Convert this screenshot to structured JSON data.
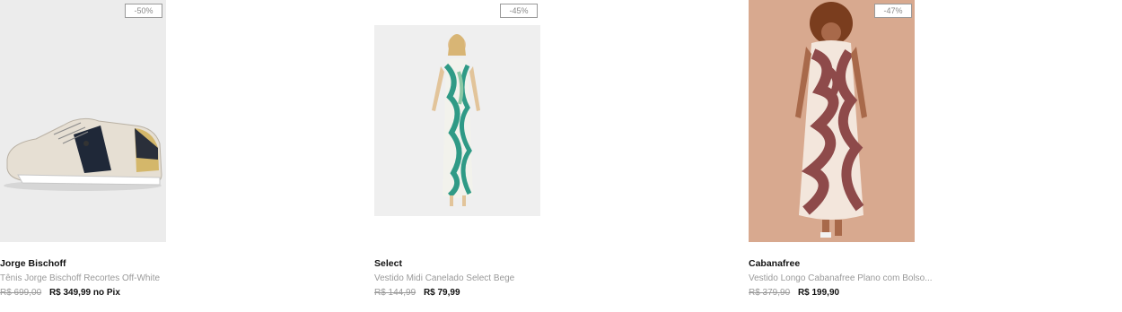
{
  "products": [
    {
      "discount": "-50%",
      "brand": "Jorge Bischoff",
      "title": "Tênis Jorge Bischoff Recortes Off-White",
      "old_price": "R$ 699,00",
      "new_price": "R$ 349,99",
      "pix_label": "no Pix",
      "image": "sneaker-photo"
    },
    {
      "discount": "-45%",
      "brand": "Select",
      "title": "Vestido Midi Canelado Select Bege",
      "old_price": "R$ 144,99",
      "new_price": "R$ 79,99",
      "image": "green-print-dress-photo"
    },
    {
      "discount": "-47%",
      "brand": "Cabanafree",
      "title": "Vestido Longo Cabanafree Plano com Bolso...",
      "old_price": "R$ 379,90",
      "new_price": "R$ 199,90",
      "image": "maroon-print-dress-photo"
    }
  ],
  "colors": {
    "badge_border": "#9a9a9a",
    "muted_text": "#9a9a9a",
    "price_text": "#111111",
    "dress_maroon": "#8e4a4a",
    "dress_green": "#2f9a86"
  }
}
